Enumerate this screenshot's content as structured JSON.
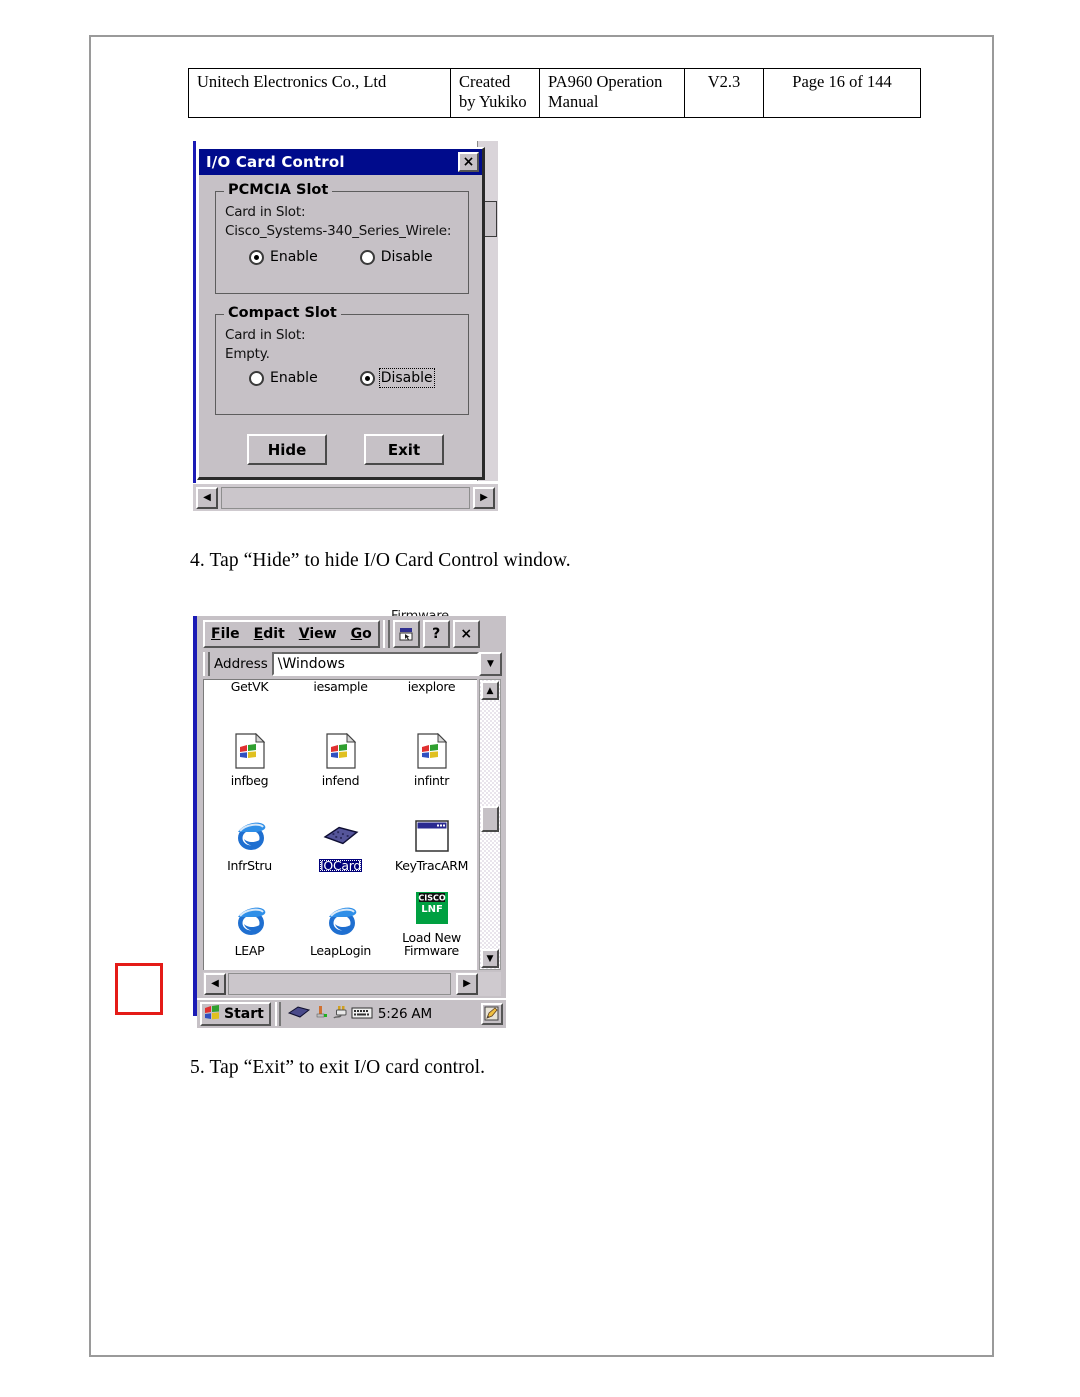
{
  "header": {
    "company": "Unitech Electronics Co., Ltd",
    "created_by": "Created\nby Yukiko",
    "manual": "PA960 Operation\nManual",
    "version": "V2.3",
    "page": "Page 16 of 144"
  },
  "instructions": {
    "step4": "4. Tap “Hide” to hide I/O Card Control window.",
    "step5": "5. Tap “Exit” to exit I/O card control."
  },
  "iocard_dialog": {
    "title": "I/O Card Control",
    "close_label": "×",
    "pcmcia": {
      "legend": "PCMCIA Slot",
      "line1": "Card in Slot:",
      "line2": "Cisco_Systems-340_Series_Wirele:",
      "enable_label": "Enable",
      "disable_label": "Disable",
      "selected": "Enable"
    },
    "compact": {
      "legend": "Compact Slot",
      "line1": "Card in Slot:",
      "line2": "Empty.",
      "enable_label": "Enable",
      "disable_label": "Disable",
      "selected": "Disable"
    },
    "hide_label": "Hide",
    "exit_label": "Exit",
    "background_label": "Firmware"
  },
  "explorer": {
    "menu": [
      {
        "label": "File",
        "accel": "F"
      },
      {
        "label": "Edit",
        "accel": "E"
      },
      {
        "label": "View",
        "accel": "V"
      },
      {
        "label": "Go",
        "accel": "G"
      }
    ],
    "help_label": "?",
    "close_label": "×",
    "address_label": "Address",
    "address_value": "\\Windows",
    "dropdown_glyph": "▼",
    "scroll_up_glyph": "▲",
    "scroll_down_glyph": "▼",
    "scroll_left_glyph": "◀",
    "scroll_right_glyph": "▶",
    "rows": [
      {
        "labels_only": true,
        "items": [
          {
            "label": "GetVK",
            "icon": "none",
            "selected": false
          },
          {
            "label": "iesample",
            "icon": "none",
            "selected": false
          },
          {
            "label": "iexplore",
            "icon": "none",
            "selected": false
          }
        ]
      },
      {
        "labels_only": false,
        "items": [
          {
            "label": "infbeg",
            "icon": "inf-document-icon",
            "selected": false
          },
          {
            "label": "infend",
            "icon": "inf-document-icon",
            "selected": false
          },
          {
            "label": "infintr",
            "icon": "inf-document-icon",
            "selected": false
          }
        ]
      },
      {
        "labels_only": false,
        "items": [
          {
            "label": "InfrStru",
            "icon": "internet-explorer-icon",
            "selected": false
          },
          {
            "label": "IOCard",
            "icon": "iocard-diamond-icon",
            "selected": true
          },
          {
            "label": "KeyTracARM",
            "icon": "window-app-icon",
            "selected": false
          }
        ]
      },
      {
        "labels_only": false,
        "items": [
          {
            "label": "LEAP",
            "icon": "internet-explorer-icon",
            "selected": false
          },
          {
            "label": "LeapLogin",
            "icon": "internet-explorer-icon",
            "selected": false
          },
          {
            "label": "Load New Firmware",
            "icon": "cisco-lnf-icon",
            "selected": false
          }
        ]
      }
    ],
    "taskbar": {
      "start_label": "Start",
      "clock": "5:26 AM"
    }
  },
  "colors": {
    "titlebar": "#000b8c",
    "dialog_face": "#c6c1c6",
    "selection": "#00007a",
    "annotation": "#e41b17",
    "cisco_green": "#00a041"
  }
}
